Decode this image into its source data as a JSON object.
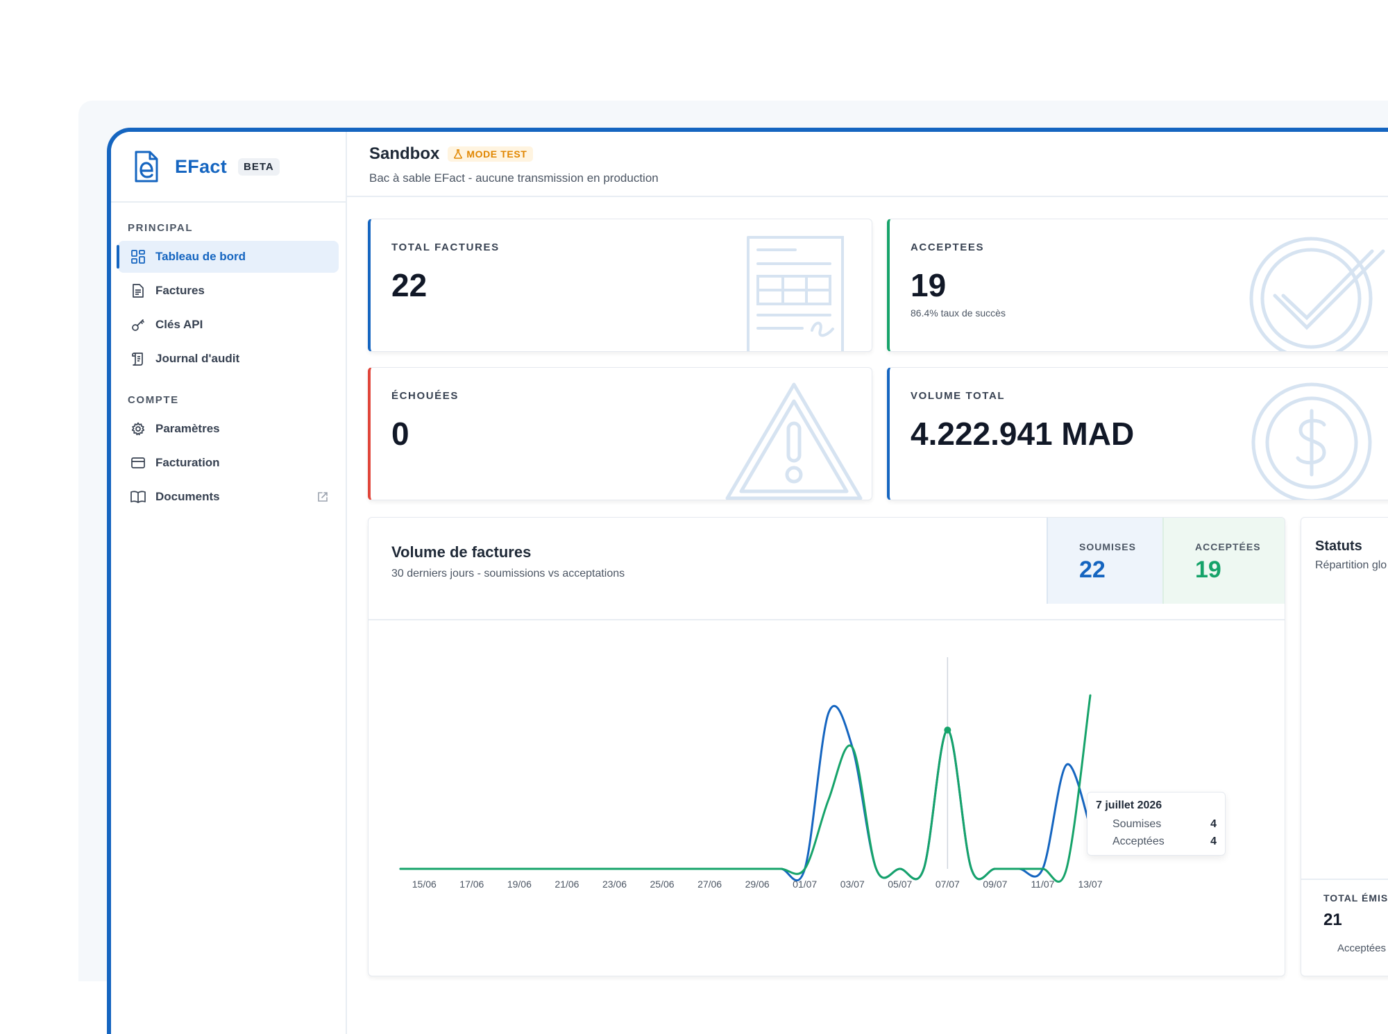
{
  "brand": {
    "name": "EFact",
    "badge": "BETA"
  },
  "sidebar": {
    "sections": [
      {
        "title": "PRINCIPAL",
        "items": [
          {
            "label": "Tableau de bord",
            "icon": "dashboard-grid-icon",
            "active": true
          },
          {
            "label": "Factures",
            "icon": "document-icon"
          },
          {
            "label": "Clés API",
            "icon": "key-icon"
          },
          {
            "label": "Journal d'audit",
            "icon": "scroll-icon"
          }
        ]
      },
      {
        "title": "COMPTE",
        "items": [
          {
            "label": "Paramètres",
            "icon": "gear-icon"
          },
          {
            "label": "Facturation",
            "icon": "credit-card-icon"
          },
          {
            "label": "Documents",
            "icon": "book-icon",
            "external": true
          }
        ]
      }
    ]
  },
  "header": {
    "title": "Sandbox",
    "badge": "MODE TEST",
    "subtitle": "Bac à sable EFact - aucune transmission en production"
  },
  "stats": {
    "total": {
      "label": "TOTAL FACTURES",
      "value": "22"
    },
    "accepted": {
      "label": "ACCEPTEES",
      "value": "19",
      "note": "86.4% taux de succès"
    },
    "failed": {
      "label": "ÉCHOUÉES",
      "value": "0"
    },
    "volume": {
      "label": "VOLUME TOTAL",
      "value": "4.222.941 MAD"
    }
  },
  "volume_panel": {
    "title": "Volume de factures",
    "subtitle": "30 derniers jours - soumissions vs acceptations",
    "kpis": {
      "submitted": {
        "label": "SOUMISES",
        "value": "22"
      },
      "accepted": {
        "label": "ACCEPTÉES",
        "value": "19"
      }
    },
    "tooltip": {
      "date": "7 juillet 2026",
      "rows": [
        {
          "label": "Soumises",
          "value": "4"
        },
        {
          "label": "Acceptées",
          "value": "4"
        }
      ]
    }
  },
  "chart_data": {
    "type": "line",
    "x": [
      "14/06",
      "15/06",
      "16/06",
      "17/06",
      "18/06",
      "19/06",
      "20/06",
      "21/06",
      "22/06",
      "23/06",
      "24/06",
      "25/06",
      "26/06",
      "27/06",
      "28/06",
      "29/06",
      "30/06",
      "01/07",
      "02/07",
      "03/07",
      "04/07",
      "05/07",
      "06/07",
      "07/07",
      "08/07",
      "09/07",
      "10/07",
      "11/07",
      "12/07",
      "13/07"
    ],
    "tick_labels": [
      "15/06",
      "17/06",
      "19/06",
      "21/06",
      "23/06",
      "25/06",
      "27/06",
      "29/06",
      "01/07",
      "03/07",
      "05/07",
      "07/07",
      "09/07",
      "11/07",
      "13/07"
    ],
    "series": [
      {
        "name": "Soumises",
        "color": "#1565c0",
        "values": [
          0,
          0,
          0,
          0,
          0,
          0,
          0,
          0,
          0,
          0,
          0,
          0,
          0,
          0,
          0,
          0,
          0,
          0,
          4.5,
          3.5,
          0,
          0,
          0,
          4,
          0,
          0,
          0,
          0,
          3,
          1.2
        ]
      },
      {
        "name": "Acceptées",
        "color": "#16a36a",
        "values": [
          0,
          0,
          0,
          0,
          0,
          0,
          0,
          0,
          0,
          0,
          0,
          0,
          0,
          0,
          0,
          0,
          0,
          0,
          2,
          3.5,
          0,
          0,
          0,
          4,
          0,
          0,
          0,
          0,
          0,
          5
        ]
      }
    ],
    "highlight_index": 23,
    "ylim": [
      -0.6,
      6
    ],
    "grid": false,
    "legend": "none"
  },
  "status_panel": {
    "title": "Statuts",
    "subtitle": "Répartition glo",
    "foot_label": "TOTAL ÉMIS",
    "foot_value": "21",
    "foot_note": "Acceptées"
  }
}
